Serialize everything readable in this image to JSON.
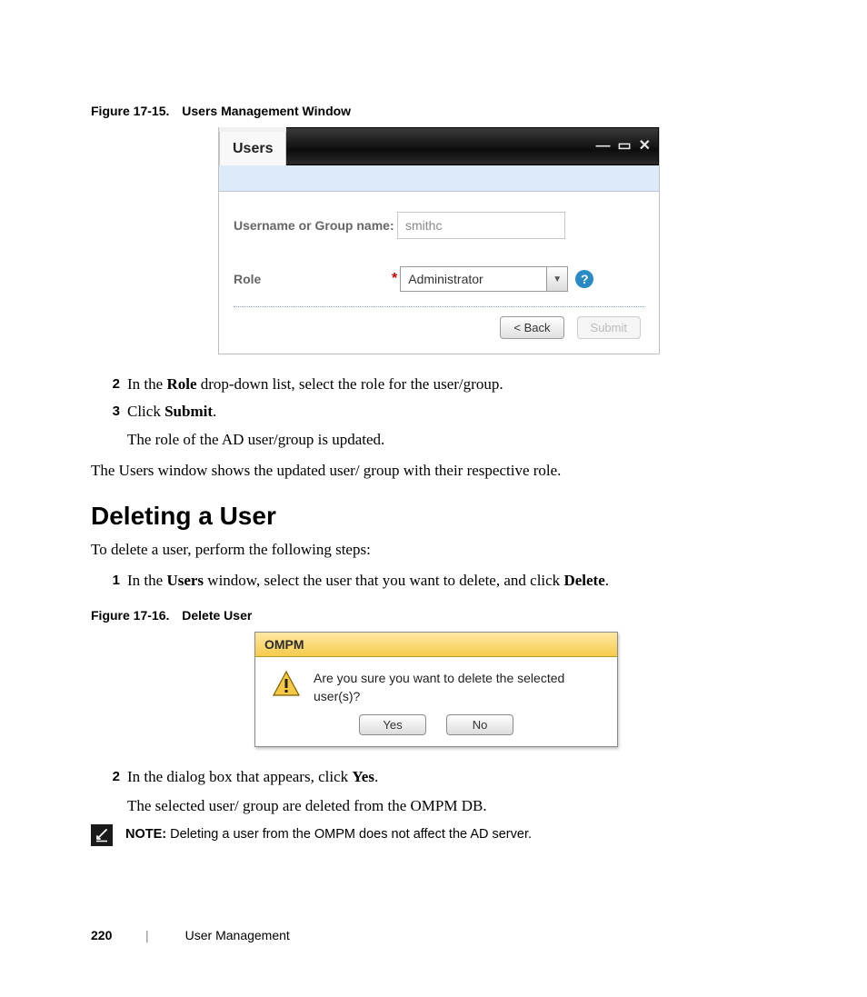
{
  "figure1": {
    "caption_label": "Figure 17-15.",
    "caption_title": "Users Management Window",
    "window_title": "Users",
    "username_label": "Username or Group name:",
    "username_value": "smithc",
    "role_label": "Role",
    "role_value": "Administrator",
    "back_button": "< Back",
    "submit_button": "Submit"
  },
  "steps_a": {
    "s2_num": "2",
    "s2_pre": "In the ",
    "s2_bold": "Role",
    "s2_post": " drop-down list, select the role for the user/group.",
    "s3_num": "3",
    "s3_pre": "Click ",
    "s3_bold": "Submit",
    "s3_post": ".",
    "s3_sub": "The role of the AD user/group is updated."
  },
  "paragraph_after_steps_a": "The Users window shows the updated user/ group with their respective role.",
  "section_heading": "Deleting a User",
  "section_intro": "To delete a user, perform the following steps:",
  "steps_b": {
    "s1_num": "1",
    "s1_pre": "In the ",
    "s1_bold1": "Users",
    "s1_mid": " window, select the user that you want to delete, and click ",
    "s1_bold2": "Delete",
    "s1_post": "."
  },
  "figure2": {
    "caption_label": "Figure 17-16.",
    "caption_title": "Delete User",
    "dialog_title": "OMPM",
    "dialog_message": "Are you sure you want to delete the selected user(s)?",
    "yes": "Yes",
    "no": "No"
  },
  "steps_c": {
    "s2_num": "2",
    "s2_pre": "In the dialog box that appears, click ",
    "s2_bold": "Yes",
    "s2_post": ".",
    "s2_sub": "The selected user/ group are deleted from the OMPM DB."
  },
  "note": {
    "label": "NOTE:",
    "text": " Deleting a user from the OMPM does not affect the AD server."
  },
  "footer": {
    "page_number": "220",
    "section": "User Management"
  }
}
